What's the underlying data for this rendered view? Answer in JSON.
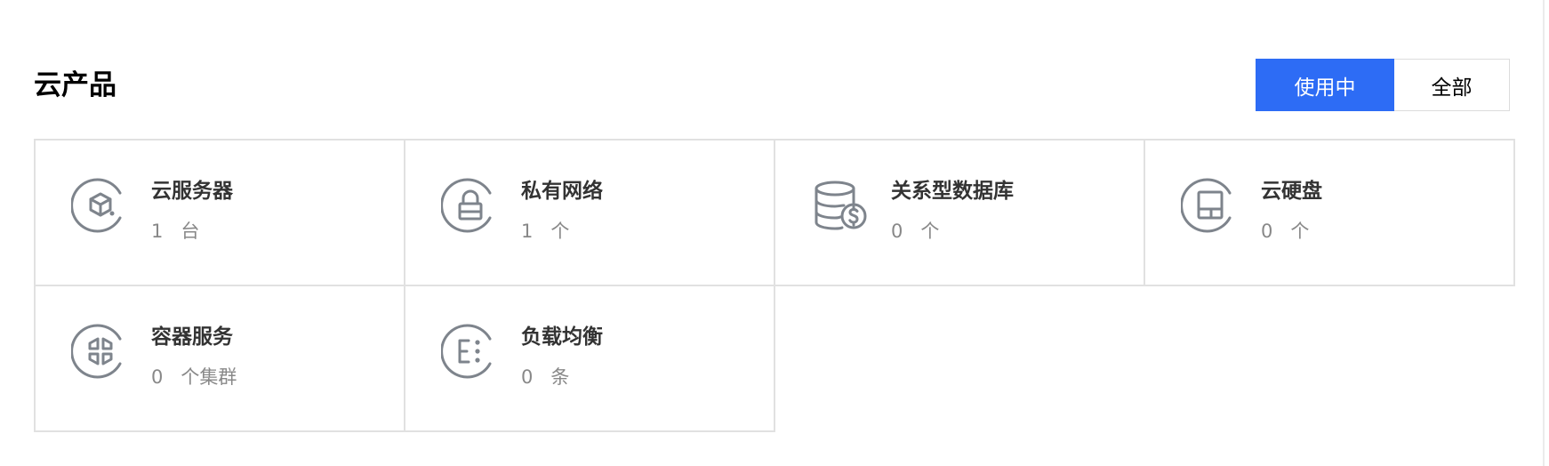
{
  "header": {
    "title": "云产品",
    "filters": [
      {
        "label": "使用中",
        "active": true
      },
      {
        "label": "全部",
        "active": false
      }
    ]
  },
  "products": [
    {
      "name": "云服务器",
      "count": "1",
      "unit": "台",
      "icon": "cube-icon"
    },
    {
      "name": "私有网络",
      "count": "1",
      "unit": "个",
      "icon": "lock-icon"
    },
    {
      "name": "关系型数据库",
      "count": "0",
      "unit": "个",
      "icon": "database-dollar-icon"
    },
    {
      "name": "云硬盘",
      "count": "0",
      "unit": "个",
      "icon": "disk-icon"
    },
    {
      "name": "容器服务",
      "count": "0",
      "unit": "个集群",
      "icon": "container-icon"
    },
    {
      "name": "负载均衡",
      "count": "0",
      "unit": "条",
      "icon": "load-balancer-icon"
    }
  ],
  "colors": {
    "accent": "#2d6cf5",
    "icon_stroke": "#7e848c",
    "border": "#e1e1e1"
  }
}
